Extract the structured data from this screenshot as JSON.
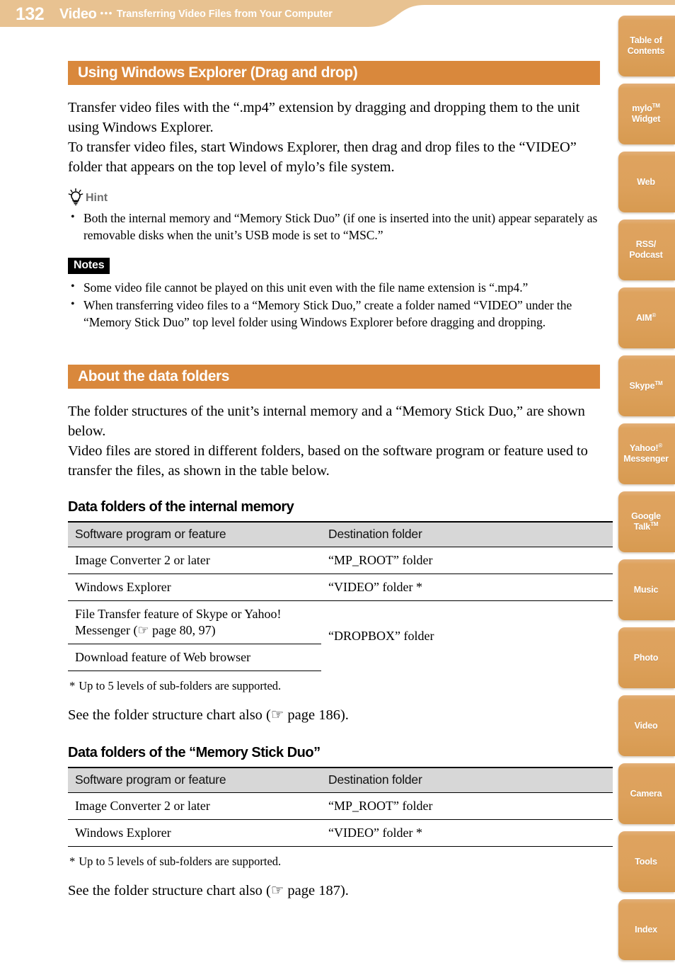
{
  "header": {
    "page_number": "132",
    "section": "Video",
    "separator": "•••",
    "subtitle": "Transferring Video Files from Your Computer",
    "banner_color": "#e8c291",
    "accent_color": "#d9883c"
  },
  "sidebar": {
    "items": [
      {
        "name": "table-of-contents",
        "line1": "Table of",
        "line2": "Contents",
        "sup1": "",
        "sup2": ""
      },
      {
        "name": "mylo-widget",
        "line1": "mylo",
        "sup1": "TM",
        "line2": "Widget",
        "sup2": ""
      },
      {
        "name": "web",
        "line1": "Web",
        "sup1": "",
        "line2": "",
        "sup2": ""
      },
      {
        "name": "rss-podcast",
        "line1": "RSS/",
        "sup1": "",
        "line2": "Podcast",
        "sup2": ""
      },
      {
        "name": "aim",
        "line1": "AIM",
        "sup1": "®",
        "line2": "",
        "sup2": ""
      },
      {
        "name": "skype",
        "line1": "Skype",
        "sup1": "TM",
        "line2": "",
        "sup2": ""
      },
      {
        "name": "yahoo-messenger",
        "line1": "Yahoo!",
        "sup1": "®",
        "line2": "Messenger",
        "sup2": ""
      },
      {
        "name": "google-talk",
        "line1": "Google",
        "sup1": "",
        "line2": "Talk",
        "sup2": "TM"
      },
      {
        "name": "music",
        "line1": "Music",
        "sup1": "",
        "line2": "",
        "sup2": ""
      },
      {
        "name": "photo",
        "line1": "Photo",
        "sup1": "",
        "line2": "",
        "sup2": ""
      },
      {
        "name": "video",
        "line1": "Video",
        "sup1": "",
        "line2": "",
        "sup2": ""
      },
      {
        "name": "camera",
        "line1": "Camera",
        "sup1": "",
        "line2": "",
        "sup2": ""
      },
      {
        "name": "tools",
        "line1": "Tools",
        "sup1": "",
        "line2": "",
        "sup2": ""
      },
      {
        "name": "index",
        "line1": "Index",
        "sup1": "",
        "line2": "",
        "sup2": ""
      }
    ]
  },
  "section1": {
    "heading": "Using Windows Explorer (Drag and drop)",
    "para1": "Transfer video files with the “.mp4” extension by dragging and dropping them to the unit using Windows Explorer.",
    "para2": "To transfer video files, start Windows Explorer, then drag and drop files to the “VIDEO” folder that appears on the top level of mylo’s file system.",
    "hint_label": "Hint",
    "hint_bullets": [
      "Both the internal memory and “Memory Stick Duo” (if one is inserted into the unit) appear separately as removable disks when the unit’s USB mode is set to “MSC.”"
    ],
    "notes_label": "Notes",
    "notes_bullets": [
      "Some video file cannot be played on this unit even with the file name extension is “.mp4.”",
      "When transferring video files to a “Memory Stick Duo,” create a folder named “VIDEO” under the “Memory Stick Duo” top level folder using Windows Explorer before dragging and dropping."
    ]
  },
  "section2": {
    "heading": "About the data folders",
    "para1": "The folder structures of the unit’s internal memory and a “Memory Stick Duo,” are shown below.",
    "para2": "Video files are stored in different folders, based on the software program or feature used to transfer the files, as shown in the table below.",
    "table1": {
      "title": "Data folders of the internal memory",
      "columns": [
        "Software program or feature",
        "Destination folder"
      ],
      "rows": [
        {
          "feature": "Image Converter 2 or later",
          "destination": "“MP_ROOT” folder"
        },
        {
          "feature": "Windows Explorer",
          "destination": "“VIDEO” folder *"
        },
        {
          "feature": "File Transfer feature of Skype or Yahoo! Messenger (☞ page 80, 97)",
          "destination": "“DROPBOX” folder"
        },
        {
          "feature": "Download feature of Web browser",
          "destination": ""
        }
      ],
      "footnote": "Up to 5 levels of sub-folders are supported.",
      "footnote_marker": "*",
      "see_also": "See the folder structure chart also (☞ page 186)."
    },
    "table2": {
      "title": "Data folders of the “Memory Stick Duo”",
      "columns": [
        "Software program or feature",
        "Destination folder"
      ],
      "rows": [
        {
          "feature": "Image Converter 2 or later",
          "destination": "“MP_ROOT” folder"
        },
        {
          "feature": "Windows Explorer",
          "destination": "“VIDEO” folder *"
        }
      ],
      "footnote": "Up to 5 levels of sub-folders are supported.",
      "footnote_marker": "*",
      "see_also": "See the folder structure chart also (☞ page 187)."
    }
  }
}
